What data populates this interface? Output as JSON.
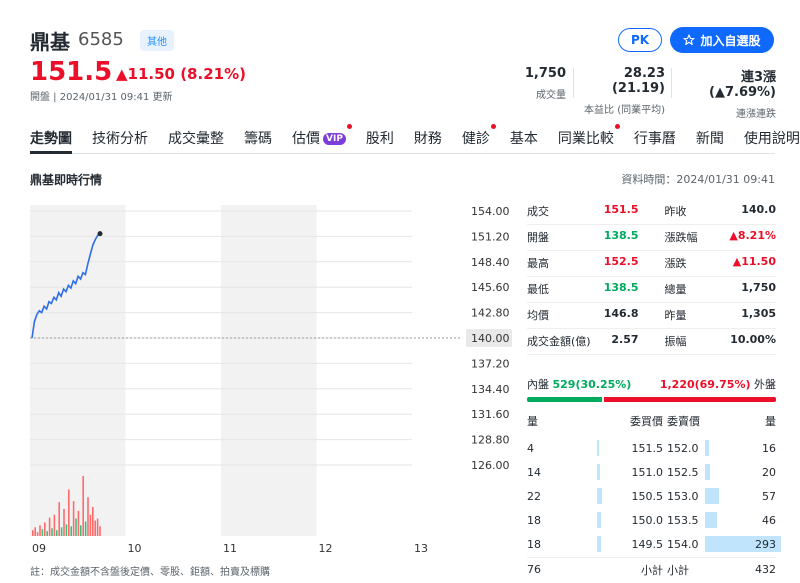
{
  "header": {
    "name": "鼎基",
    "code": "6585",
    "tag": "其他",
    "pk_label": "PK",
    "watch_label": "加入自選股",
    "price": "151.5",
    "change": "▲11.50 (8.21%)",
    "meta": "開盤 | 2024/01/31 09:41 更新"
  },
  "stats": [
    {
      "value": "1,750",
      "label": "成交量"
    },
    {
      "value": "28.23 (21.19)",
      "label": "本益比 (同業平均)"
    },
    {
      "value": "連3漲 (▲7.69%)",
      "label": "連漲連跌"
    }
  ],
  "nav": [
    {
      "label": "走勢圖",
      "active": true
    },
    {
      "label": "技術分析"
    },
    {
      "label": "成交彙整"
    },
    {
      "label": "籌碼"
    },
    {
      "label": "估價",
      "vip": "VIP",
      "dot": true
    },
    {
      "label": "股利"
    },
    {
      "label": "財務"
    },
    {
      "label": "健診",
      "dot": true
    },
    {
      "label": "基本"
    },
    {
      "label": "同業比較",
      "dot": true
    },
    {
      "label": "行事曆"
    },
    {
      "label": "新聞"
    },
    {
      "label": "使用說明"
    }
  ],
  "section": {
    "title": "鼎基即時行情",
    "data_time": "資料時間：2024/01/31 09:41"
  },
  "chart_data": {
    "type": "line",
    "x_ticks": [
      "09",
      "10",
      "11",
      "12",
      "13"
    ],
    "y_ticks": [
      "154.00",
      "151.20",
      "148.40",
      "145.60",
      "142.80",
      "140.00",
      "137.20",
      "134.40",
      "131.60",
      "128.80",
      "126.00"
    ],
    "reference": "140.00",
    "ylim": [
      126,
      154
    ],
    "series": [
      {
        "values": [
          140.0,
          141.8,
          142.6,
          143.0,
          142.8,
          143.5,
          143.2,
          144.0,
          143.8,
          144.5,
          144.2,
          145.0,
          144.6,
          145.4,
          145.1,
          145.8,
          145.5,
          146.3,
          146.0,
          146.8,
          146.5,
          147.2,
          147.0,
          148.2,
          149.2,
          150.2,
          150.8,
          151.3,
          151.5
        ]
      }
    ],
    "volume": [
      6,
      9,
      4,
      11,
      7,
      14,
      5,
      19,
      8,
      22,
      6,
      35,
      9,
      28,
      12,
      48,
      10,
      36,
      18,
      26,
      11,
      62,
      15,
      40,
      22,
      30,
      16,
      18,
      10
    ]
  },
  "quote": {
    "rows": [
      {
        "l1": "成交",
        "v1": "151.5",
        "c1": "up",
        "l2": "昨收",
        "v2": "140.0",
        "c2": ""
      },
      {
        "l1": "開盤",
        "v1": "138.5",
        "c1": "dn",
        "l2": "漲跌幅",
        "v2": "▲8.21%",
        "c2": "up"
      },
      {
        "l1": "最高",
        "v1": "152.5",
        "c1": "up",
        "l2": "漲跌",
        "v2": "▲11.50",
        "c2": "up"
      },
      {
        "l1": "最低",
        "v1": "138.5",
        "c1": "dn",
        "l2": "總量",
        "v2": "1,750",
        "c2": ""
      },
      {
        "l1": "均價",
        "v1": "146.8",
        "c1": "",
        "l2": "昨量",
        "v2": "1,305",
        "c2": ""
      },
      {
        "l1": "成交金額(億)",
        "v1": "2.57",
        "c1": "",
        "l2": "振幅",
        "v2": "10.00%",
        "c2": ""
      }
    ],
    "inner_label": "內盤",
    "inner_value": "529(30.25%)",
    "inner_ratio": 0.3025,
    "outer_value": "1,220(69.75%)",
    "outer_label": "外盤"
  },
  "orderbook": {
    "head": [
      "量",
      "委買價",
      "委賣價",
      "量"
    ],
    "rows": [
      {
        "bid_vol": "4",
        "bid": "151.5",
        "ask": "152.0",
        "ask_vol": "16",
        "bid_fill": 0.02,
        "ask_fill": 0.05
      },
      {
        "bid_vol": "14",
        "bid": "151.0",
        "ask": "152.5",
        "ask_vol": "20",
        "bid_fill": 0.05,
        "ask_fill": 0.07
      },
      {
        "bid_vol": "22",
        "bid": "150.5",
        "ask": "153.0",
        "ask_vol": "57",
        "bid_fill": 0.08,
        "ask_fill": 0.19
      },
      {
        "bid_vol": "18",
        "bid": "150.0",
        "ask": "153.5",
        "ask_vol": "46",
        "bid_fill": 0.06,
        "ask_fill": 0.16
      },
      {
        "bid_vol": "18",
        "bid": "149.5",
        "ask": "154.0",
        "ask_vol": "293",
        "bid_fill": 0.06,
        "ask_fill": 1.0
      }
    ],
    "total_bid": "76",
    "subtotal_label": "小計",
    "total_ask": "432"
  },
  "note": "註：成交金額不含盤後定價、零股、鉅額、拍賣及標購"
}
